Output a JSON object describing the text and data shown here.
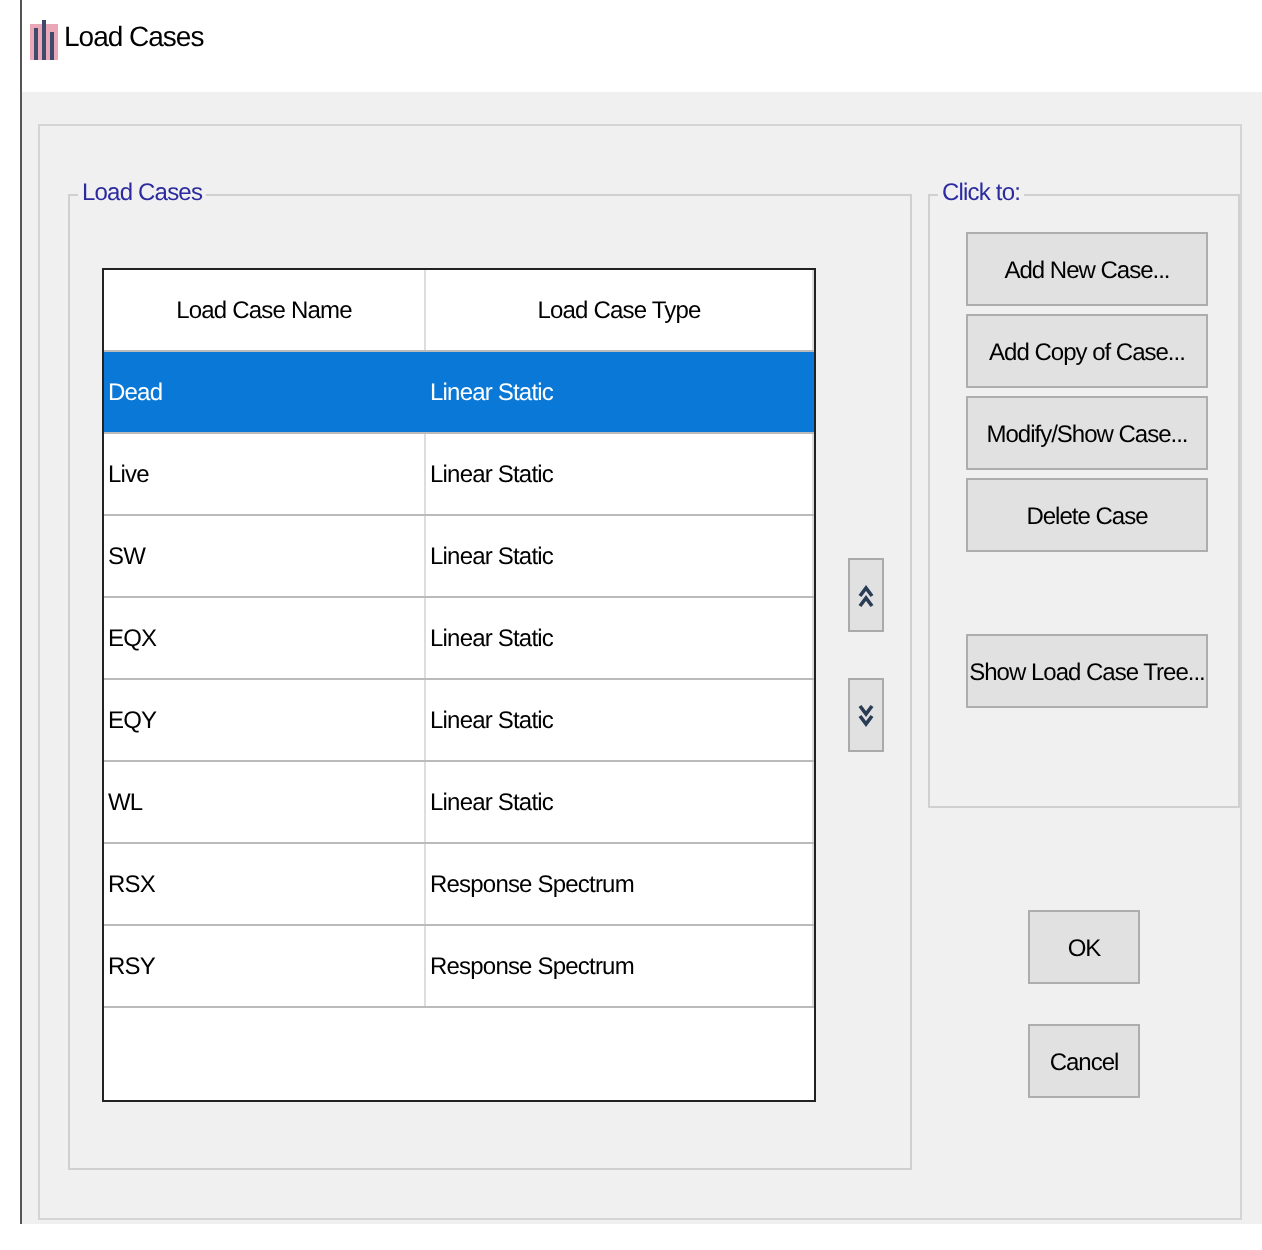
{
  "window": {
    "title": "Load Cases"
  },
  "load_cases": {
    "label": "Load Cases",
    "columns": [
      "Load Case Name",
      "Load Case Type"
    ],
    "rows": [
      {
        "name": "Dead",
        "type": "Linear Static",
        "selected": true
      },
      {
        "name": "Live",
        "type": "Linear Static",
        "selected": false
      },
      {
        "name": "SW",
        "type": "Linear Static",
        "selected": false
      },
      {
        "name": "EQX",
        "type": "Linear Static",
        "selected": false
      },
      {
        "name": "EQY",
        "type": "Linear Static",
        "selected": false
      },
      {
        "name": "WL",
        "type": "Linear Static",
        "selected": false
      },
      {
        "name": "RSX",
        "type": "Response Spectrum",
        "selected": false
      },
      {
        "name": "RSY",
        "type": "Response Spectrum",
        "selected": false
      }
    ]
  },
  "click_to": {
    "label": "Click to:",
    "buttons": [
      "Add New Case...",
      "Add Copy of Case...",
      "Modify/Show Case...",
      "Delete Case"
    ],
    "extra_button": "Show Load Case Tree..."
  },
  "buttons": [
    "OK",
    "Cancel"
  ]
}
